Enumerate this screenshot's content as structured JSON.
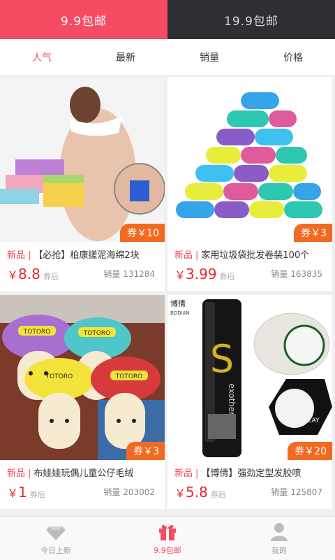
{
  "top_tabs": [
    {
      "label": "9.9包邮"
    },
    {
      "label": "19.9包邮"
    }
  ],
  "sort_tabs": [
    {
      "label": "人气"
    },
    {
      "label": "最新"
    },
    {
      "label": "销量"
    },
    {
      "label": "价格"
    }
  ],
  "products": [
    {
      "coupon": "券￥10",
      "tag": "新品",
      "title": "【必抢】柏康搓泥海绵2块",
      "price_symbol": "￥",
      "price": "8.8",
      "price_note": "券后",
      "sales": "销量 131284"
    },
    {
      "coupon": "券￥3",
      "tag": "新品",
      "title": "家用垃圾袋批发卷装100个",
      "price_symbol": "￥",
      "price": "3.99",
      "price_note": "券后",
      "sales": "销量 163835"
    },
    {
      "coupon": "券￥3",
      "tag": "新品",
      "title": "布娃娃玩偶儿童公仔毛绒",
      "price_symbol": "￥",
      "price": "1",
      "price_note": "券后",
      "sales": "销量 203002"
    },
    {
      "coupon": "券￥20",
      "tag": "新品",
      "title": "【博倩】强劲定型发胶喷",
      "price_symbol": "￥",
      "price": "5.8",
      "price_note": "券后",
      "sales": "销量 125807"
    }
  ],
  "image_texts": {
    "totoro": "TOTORO",
    "brand_cn": "博倩",
    "brand_en": "BODIAN",
    "exo": "exothermic",
    "clay": "CLAY"
  },
  "bottom_nav": [
    {
      "label": "今日上新",
      "icon": "diamond-icon"
    },
    {
      "label": "9.9包邮",
      "icon": "gift-icon"
    },
    {
      "label": "我的",
      "icon": "user-icon"
    }
  ],
  "colors": {
    "accent": "#f54b63",
    "dark_tab": "#2f2f33",
    "coupon": "#f26a21",
    "price": "#e8292f"
  }
}
